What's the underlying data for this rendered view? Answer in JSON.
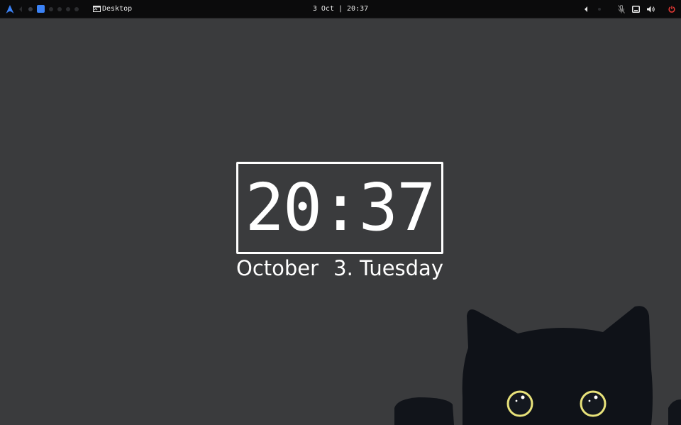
{
  "panel": {
    "window_title": "Desktop",
    "clock": "3 Oct | 20:37",
    "workspaces": [
      "1",
      "2",
      "3",
      "4",
      "5",
      "6"
    ],
    "active_workspace": "3"
  },
  "widget": {
    "time": "20:37",
    "month": "October",
    "day": "3. Tuesday"
  },
  "icons": {
    "launcher": "arch-logo-icon",
    "window": "window-icon",
    "tray_arrow": "chevron-left-icon",
    "mic": "microphone-muted-icon",
    "screen": "screen-icon",
    "volume": "volume-icon",
    "power": "power-icon"
  },
  "colors": {
    "background": "#3a3b3d",
    "panel": "#0b0b0c",
    "accent": "#3b82f6",
    "power": "#e53935",
    "cat": "#0f1218",
    "cat_eyes": "#e8e27a"
  }
}
